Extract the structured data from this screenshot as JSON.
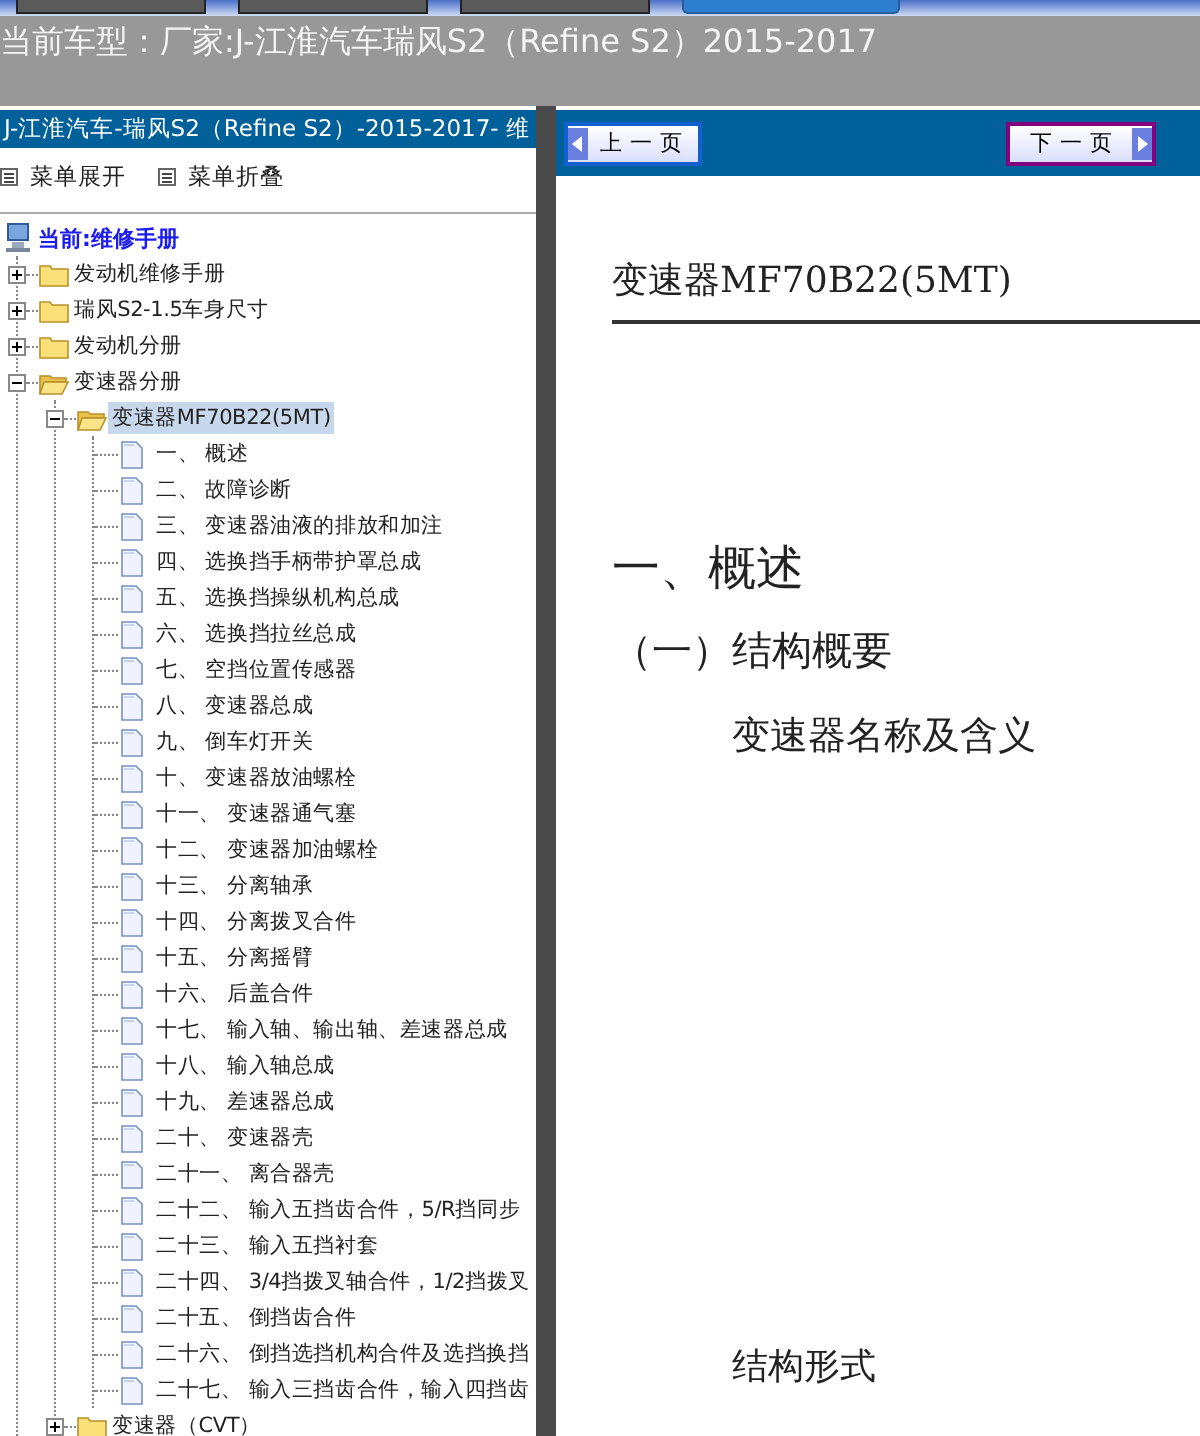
{
  "app_bar": {
    "title": "当前车型：厂家:J-江淮汽车瑞风S2（Refine S2）2015-2017"
  },
  "sidebar": {
    "header": "J-江淮汽车-瑞风S2（Refine S2）-2015-2017- 维",
    "actions": [
      "菜单展开",
      "菜单折叠"
    ],
    "tree": {
      "label": "当前:维修手册",
      "children": [
        {
          "kind": "folder",
          "label": "发动机维修手册",
          "expanded": false,
          "selected": false
        },
        {
          "kind": "folder",
          "label": "瑞风S2-1.5车身尺寸",
          "expanded": false,
          "selected": false
        },
        {
          "kind": "folder",
          "label": "发动机分册",
          "expanded": false,
          "selected": false
        },
        {
          "kind": "folder",
          "label": "变速器分册",
          "expanded": true,
          "selected": false,
          "children": [
            {
              "kind": "folder",
              "label": "变速器MF70B22(5MT)",
              "expanded": true,
              "selected": true,
              "children": [
                {
                  "kind": "page",
                  "label": "一、 概述",
                  "selected": false
                },
                {
                  "kind": "page",
                  "label": "二、 故障诊断",
                  "selected": false
                },
                {
                  "kind": "page",
                  "label": "三、 变速器油液的排放和加注",
                  "selected": false
                },
                {
                  "kind": "page",
                  "label": "四、 选换挡手柄带护罩总成",
                  "selected": false
                },
                {
                  "kind": "page",
                  "label": "五、 选换挡操纵机构总成",
                  "selected": false
                },
                {
                  "kind": "page",
                  "label": "六、 选换挡拉丝总成",
                  "selected": false
                },
                {
                  "kind": "page",
                  "label": "七、 空挡位置传感器",
                  "selected": false
                },
                {
                  "kind": "page",
                  "label": "八、 变速器总成",
                  "selected": false
                },
                {
                  "kind": "page",
                  "label": "九、 倒车灯开关",
                  "selected": false
                },
                {
                  "kind": "page",
                  "label": "十、 变速器放油螺栓",
                  "selected": false
                },
                {
                  "kind": "page",
                  "label": "十一、 变速器通气塞",
                  "selected": false
                },
                {
                  "kind": "page",
                  "label": "十二、 变速器加油螺栓",
                  "selected": false
                },
                {
                  "kind": "page",
                  "label": "十三、 分离轴承",
                  "selected": false
                },
                {
                  "kind": "page",
                  "label": "十四、 分离拨叉合件",
                  "selected": false
                },
                {
                  "kind": "page",
                  "label": "十五、 分离摇臂",
                  "selected": false
                },
                {
                  "kind": "page",
                  "label": "十六、 后盖合件",
                  "selected": false
                },
                {
                  "kind": "page",
                  "label": "十七、 输入轴、输出轴、差速器总成",
                  "selected": false
                },
                {
                  "kind": "page",
                  "label": "十八、 输入轴总成",
                  "selected": false
                },
                {
                  "kind": "page",
                  "label": "十九、 差速器总成",
                  "selected": false
                },
                {
                  "kind": "page",
                  "label": "二十、 变速器壳",
                  "selected": false
                },
                {
                  "kind": "page",
                  "label": "二十一、 离合器壳",
                  "selected": false
                },
                {
                  "kind": "page",
                  "label": "二十二、 输入五挡齿合件，5/R挡同步",
                  "selected": false
                },
                {
                  "kind": "page",
                  "label": "二十三、 输入五挡衬套",
                  "selected": false
                },
                {
                  "kind": "page",
                  "label": "二十四、 3/4挡拨叉轴合件，1/2挡拨叉",
                  "selected": false
                },
                {
                  "kind": "page",
                  "label": "二十五、 倒挡齿合件",
                  "selected": false
                },
                {
                  "kind": "page",
                  "label": "二十六、 倒挡选挡机构合件及选挡换挡",
                  "selected": false
                },
                {
                  "kind": "page",
                  "label": "二十七、 输入三挡齿合件，输入四挡齿",
                  "selected": false
                }
              ]
            },
            {
              "kind": "folder",
              "label": "变速器（CVT）",
              "expanded": false,
              "selected": false
            }
          ]
        }
      ]
    }
  },
  "viewer": {
    "buttons": [
      {
        "label": "上一页",
        "focused": false
      },
      {
        "label": "下一页",
        "focused": true
      }
    ],
    "document": [
      {
        "kind": "title",
        "text": "变速器MF70B22(5MT)"
      },
      {
        "kind": "h1",
        "text": "一、概述"
      },
      {
        "kind": "h2",
        "text": "（一）结构概要"
      },
      {
        "kind": "h3",
        "text": "变速器名称及含义"
      },
      {
        "kind": "spacer"
      },
      {
        "kind": "h4",
        "text": "结构形式"
      }
    ]
  }
}
